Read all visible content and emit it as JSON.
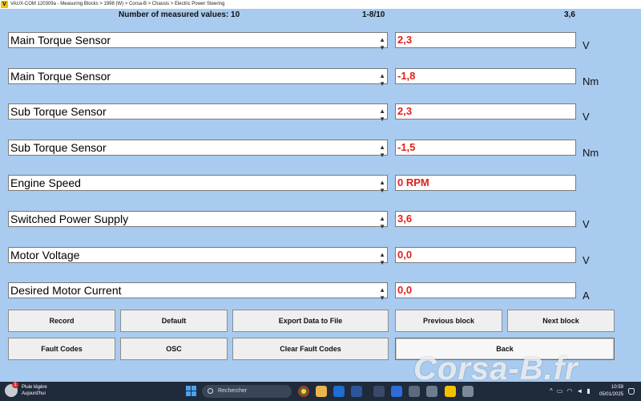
{
  "window": {
    "logo": "V",
    "title": "VAUX-COM 120309a - Measuring Blocks > 1998 (W) > Corsa-B > Chassis > Electric Power Steering"
  },
  "header": {
    "count_label": "Number of measured values: 10",
    "range": "1-8/10",
    "right_value": "3,6"
  },
  "rows": [
    {
      "name": "Main Torque Sensor",
      "value": "2,3",
      "unit": "V"
    },
    {
      "name": "Main Torque Sensor",
      "value": "-1,8",
      "unit": "Nm"
    },
    {
      "name": "Sub Torque Sensor",
      "value": "2,3",
      "unit": "V"
    },
    {
      "name": "Sub Torque Sensor",
      "value": "-1,5",
      "unit": "Nm"
    },
    {
      "name": "Engine Speed",
      "value": "0 RPM",
      "unit": ""
    },
    {
      "name": "Switched Power Supply",
      "value": "3,6",
      "unit": "V"
    },
    {
      "name": "Motor Voltage",
      "value": "0,0",
      "unit": "V"
    },
    {
      "name": "Desired Motor Current",
      "value": "0,0",
      "unit": "A"
    }
  ],
  "buttons": {
    "record": "Record",
    "default": "Default",
    "export": "Export Data to File",
    "previous": "Previous block",
    "next": "Next block",
    "fault_codes": "Fault Codes",
    "osc": "OSC",
    "clear_fault_codes": "Clear Fault Codes",
    "back": "Back"
  },
  "watermark": "Corsa-B.fr",
  "taskbar": {
    "weather_line1": "Pluie légère",
    "weather_line2": "Aujourd'hui",
    "weather_badge": "1",
    "search_placeholder": "Rechercher",
    "time": "10:59",
    "date": "05/01/2025"
  },
  "colors": {
    "background": "#a9cbef",
    "value_text": "#e0201a",
    "taskbar": "#1f2a3b"
  }
}
